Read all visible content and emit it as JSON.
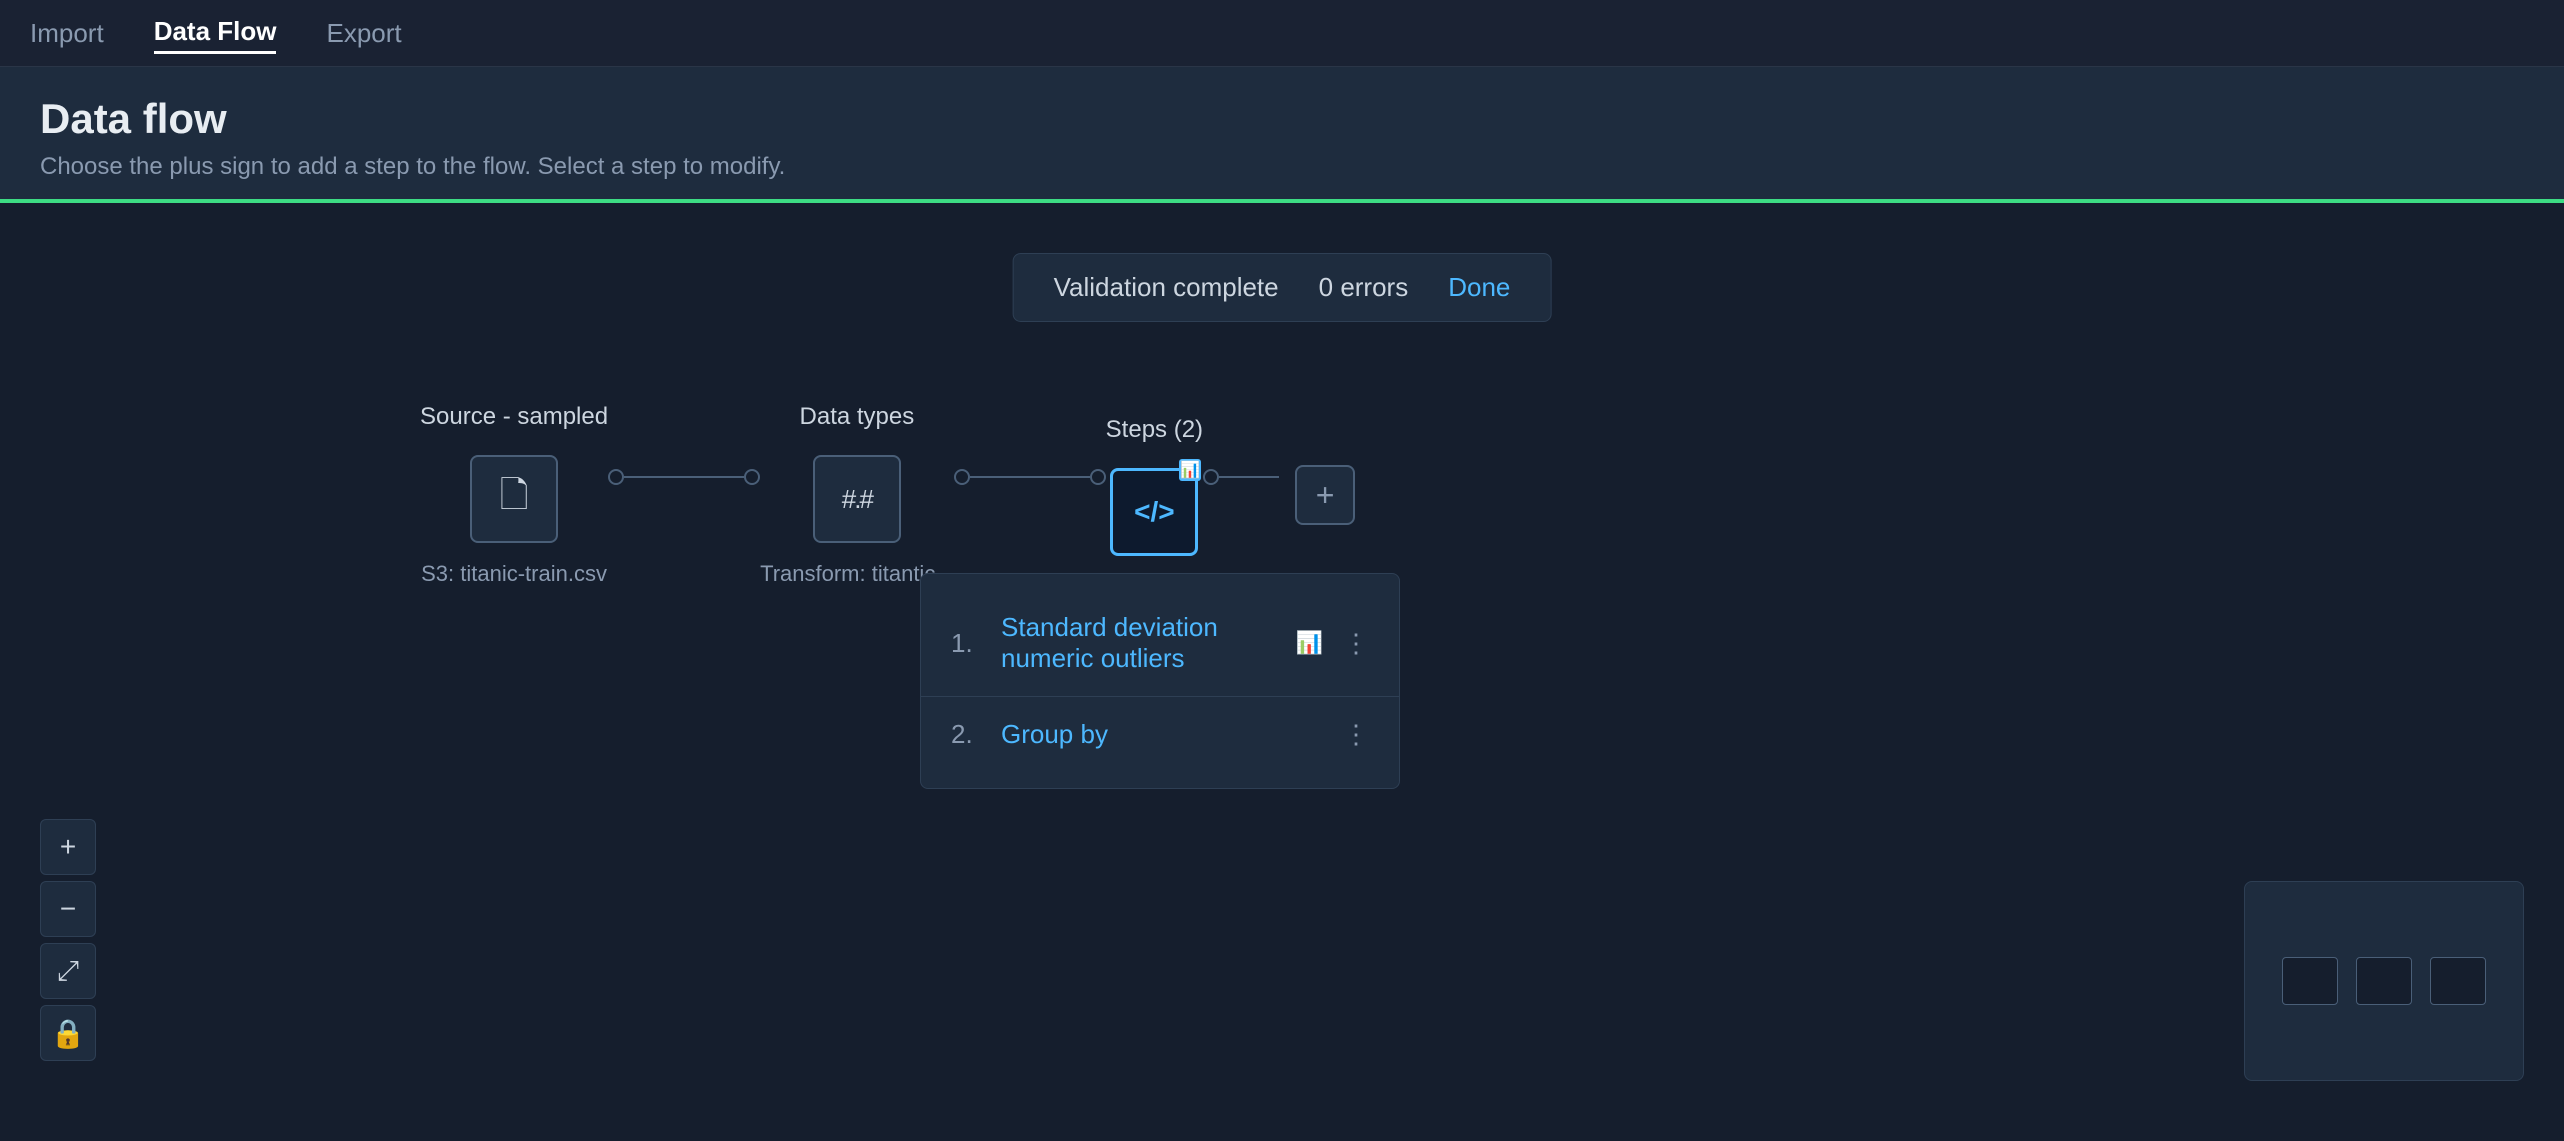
{
  "nav": {
    "items": [
      {
        "label": "Import",
        "active": false
      },
      {
        "label": "Data Flow",
        "active": true
      },
      {
        "label": "Export",
        "active": false
      }
    ]
  },
  "page": {
    "title": "Data flow",
    "subtitle": "Choose the plus sign to add a step to the flow. Select a step to modify."
  },
  "validation": {
    "message": "Validation complete",
    "errors": "0 errors",
    "done_label": "Done"
  },
  "nodes": [
    {
      "label": "Source - sampled",
      "sublabel": "S3: titanic-train.csv",
      "icon": "document",
      "type": "source"
    },
    {
      "label": "Data types",
      "sublabel": "Transform: titantic...",
      "icon": "hash",
      "type": "transform"
    },
    {
      "label": "Steps (2)",
      "sublabel": "",
      "icon": "code",
      "type": "steps",
      "active": true
    }
  ],
  "steps_popup": {
    "items": [
      {
        "num": "1.",
        "label": "Standard deviation numeric outliers",
        "has_chart": true,
        "has_more": true
      },
      {
        "num": "2.",
        "label": "Group by",
        "has_chart": false,
        "has_more": true
      }
    ]
  },
  "zoom_controls": [
    {
      "label": "+",
      "name": "zoom-in"
    },
    {
      "label": "−",
      "name": "zoom-out"
    },
    {
      "label": "⤢",
      "name": "fit-screen"
    },
    {
      "label": "🔒",
      "name": "lock"
    }
  ],
  "icons": {
    "document": "🗋",
    "hash": "#.#",
    "code": "</>",
    "chart": "📊",
    "more": "⋮",
    "plus": "+"
  }
}
